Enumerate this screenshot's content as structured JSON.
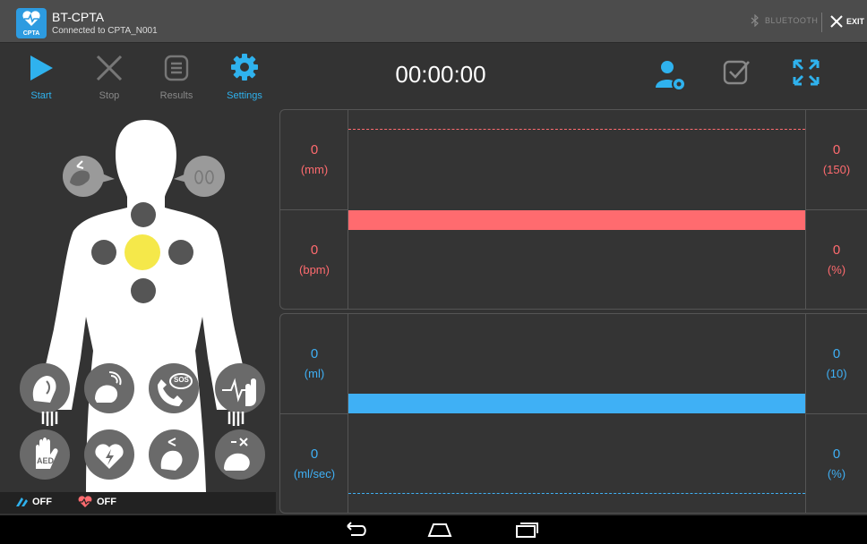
{
  "app": {
    "title": "BT-CPTA",
    "subtitle": "Connected to CPTA_N001",
    "logo_text": "CPTA",
    "bluetooth_label": "BLUETOOTH",
    "exit_label": "EXIT"
  },
  "toolbar": {
    "start_label": "Start",
    "stop_label": "Stop",
    "results_label": "Results",
    "settings_label": "Settings",
    "timer": "00:00:00"
  },
  "status": {
    "channel_a": "OFF",
    "channel_b": "OFF"
  },
  "readouts": {
    "depth": {
      "value": "0",
      "unit": "(mm)"
    },
    "target": {
      "value": "0",
      "unit": "(150)"
    },
    "rate": {
      "value": "0",
      "unit": "(bpm)"
    },
    "rate_pct": {
      "value": "0",
      "unit": "(%)"
    },
    "volume": {
      "value": "0",
      "unit": "(ml)"
    },
    "volume_target": {
      "value": "0",
      "unit": "(10)"
    },
    "flow": {
      "value": "0",
      "unit": "(ml/sec)"
    },
    "flow_pct": {
      "value": "0",
      "unit": "(%)"
    }
  },
  "aed_label": "AED",
  "sos_label": "SOS",
  "colors": {
    "accent": "#2fb2ee",
    "compression": "#ff6b6f",
    "ventilation": "#3fb0f5",
    "pad_active": "#f5e84a",
    "pad_inactive": "#555555"
  }
}
